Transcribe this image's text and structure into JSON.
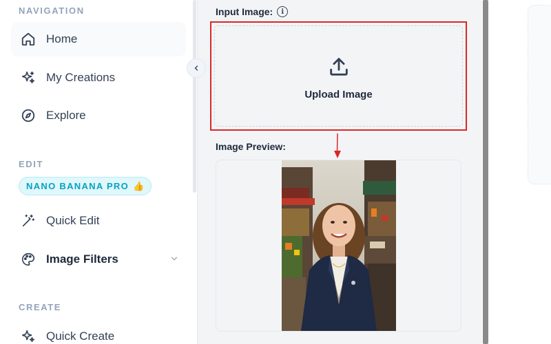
{
  "sidebar": {
    "sections": {
      "navigation": "NAVIGATION",
      "edit": "EDIT",
      "create": "CREATE"
    },
    "nav_items": [
      {
        "label": "Home",
        "icon": "home-icon",
        "active": true
      },
      {
        "label": "My Creations",
        "icon": "sparkles-icon"
      },
      {
        "label": "Explore",
        "icon": "compass-icon"
      }
    ],
    "promo": {
      "label": "NANO BANANA PRO",
      "emoji": "👍"
    },
    "edit_items": [
      {
        "label": "Quick Edit",
        "icon": "magic-wand-icon"
      },
      {
        "label": "Image Filters",
        "icon": "palette-icon",
        "has_chevron": true
      }
    ],
    "create_items": [
      {
        "label": "Quick Create",
        "icon": "sparkles-icon"
      }
    ]
  },
  "main": {
    "input_label": "Input Image:",
    "upload_label": "Upload Image",
    "preview_label": "Image Preview:"
  },
  "colors": {
    "accent": "#06a2c2",
    "highlight": "#dc2626"
  }
}
